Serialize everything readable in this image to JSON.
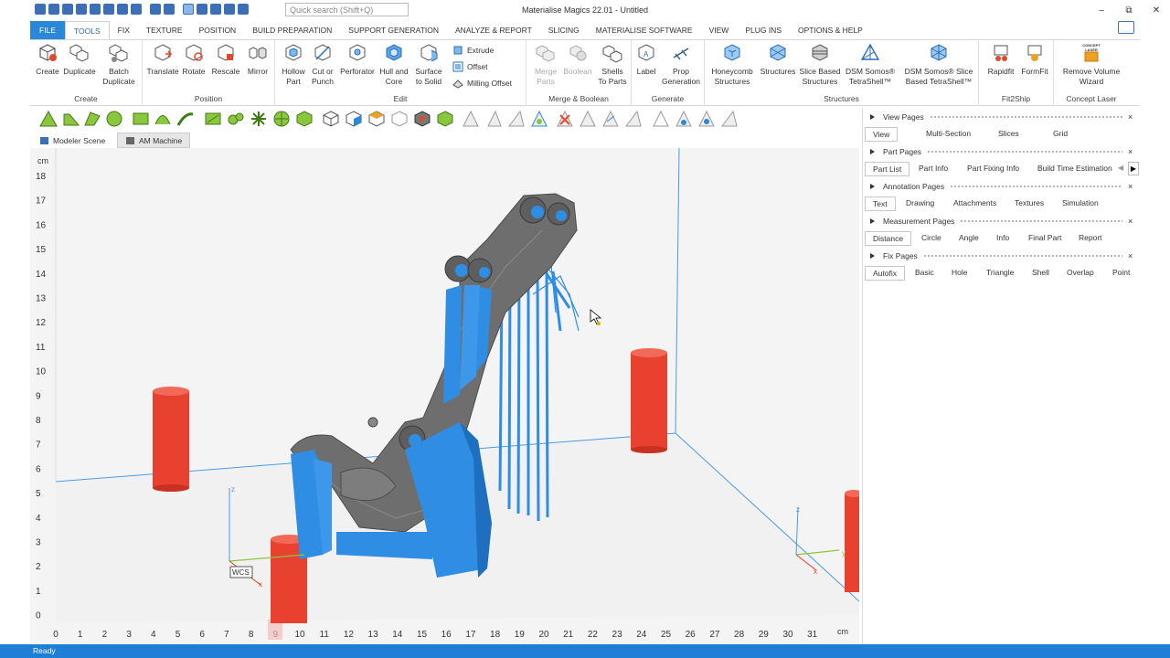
{
  "app": {
    "title": "Materialise Magics 22.01 - Untitled",
    "search_placeholder": "Quick search (Shift+Q)",
    "window_controls": [
      "–",
      "⧉",
      "✕"
    ]
  },
  "menu": [
    "FILE",
    "TOOLS",
    "FIX",
    "TEXTURE",
    "POSITION",
    "BUILD PREPARATION",
    "SUPPORT GENERATION",
    "ANALYZE & REPORT",
    "SLICING",
    "MATERIALISE SOFTWARE",
    "VIEW",
    "PLUG INS",
    "OPTIONS & HELP"
  ],
  "ribbon": {
    "create": {
      "label": "Create",
      "create": "Create",
      "duplicate": "Duplicate",
      "batch1": "Batch",
      "batch2": "Duplicate"
    },
    "position": {
      "label": "Position",
      "translate": "Translate",
      "rotate": "Rotate",
      "rescale": "Rescale",
      "mirror": "Mirror"
    },
    "edit": {
      "label": "Edit",
      "hollow1": "Hollow",
      "hollow2": "Part",
      "cut1": "Cut or",
      "cut2": "Punch",
      "perforator": "Perforator",
      "hull1": "Hull and",
      "hull2": "Core",
      "surface1": "Surface",
      "surface2": "to Solid",
      "extrude": "Extrude",
      "offset": "Offset",
      "milling": "Milling Offset"
    },
    "merge": {
      "label": "Merge & Boolean",
      "merge1": "Merge",
      "merge2": "Parts",
      "boolean": "Boolean",
      "shells1": "Shells",
      "shells2": "To Parts"
    },
    "generate": {
      "label": "Generate",
      "label_btn": "Label",
      "prop1": "Prop",
      "prop2": "Generation"
    },
    "structures": {
      "label": "Structures",
      "honey1": "Honeycomb",
      "honey2": "Structures",
      "structures": "Structures",
      "slice1": "Slice Based",
      "slice2": "Structures",
      "dsm1": "DSM Somos®",
      "dsm2": "TetraShell™",
      "dsms1": "DSM Somos® Slice",
      "dsms2": "Based TetraShell™"
    },
    "fit2ship": {
      "label": "Fit2Ship",
      "rapidfit": "Rapidfit",
      "formfit": "FormFit"
    },
    "concept": {
      "label": "Concept Laser",
      "remove1": "Remove Volume",
      "remove2": "Wizard",
      "badge": "CONCEPT LASER"
    }
  },
  "scene_tabs": {
    "modeler": "Modeler Scene",
    "am": "AM Machine"
  },
  "viewport": {
    "unit": "cm",
    "y_ticks": [
      "18",
      "17",
      "16",
      "15",
      "14",
      "13",
      "12",
      "11",
      "10",
      "9",
      "8",
      "7",
      "6",
      "5",
      "4",
      "3",
      "2",
      "1",
      "0"
    ],
    "x_ticks": [
      "0",
      "1",
      "2",
      "3",
      "4",
      "5",
      "6",
      "7",
      "8",
      "9",
      "10",
      "11",
      "12",
      "13",
      "14",
      "15",
      "16",
      "17",
      "18",
      "19",
      "20",
      "21",
      "22",
      "23",
      "24",
      "25",
      "26",
      "27",
      "28",
      "29",
      "30",
      "31"
    ],
    "wcs": "WCS",
    "axis_z": "z",
    "axis_x": "x",
    "axis_y": "y"
  },
  "panel": {
    "view_pages": {
      "title": "View Pages",
      "tabs": [
        "View",
        "Multi-Section",
        "Slices",
        "Grid"
      ]
    },
    "part_pages": {
      "title": "Part Pages",
      "tabs": [
        "Part List",
        "Part Info",
        "Part Fixing Info",
        "Build Time Estimation"
      ]
    },
    "annotation_pages": {
      "title": "Annotation Pages",
      "tabs": [
        "Text",
        "Drawing",
        "Attachments",
        "Textures",
        "Simulation"
      ]
    },
    "measurement_pages": {
      "title": "Measurement Pages",
      "tabs": [
        "Distance",
        "Circle",
        "Angle",
        "Info",
        "Final Part",
        "Report"
      ]
    },
    "fix_pages": {
      "title": "Fix Pages",
      "tabs": [
        "Autofix",
        "Basic",
        "Hole",
        "Triangle",
        "Shell",
        "Overlap",
        "Point"
      ]
    }
  },
  "status": "Ready",
  "colors": {
    "accent": "#2b88d8",
    "support": "#2f8de4",
    "part": "#6e6e6e",
    "cylinder": "#e8412f",
    "status": "#1f7fd6"
  }
}
